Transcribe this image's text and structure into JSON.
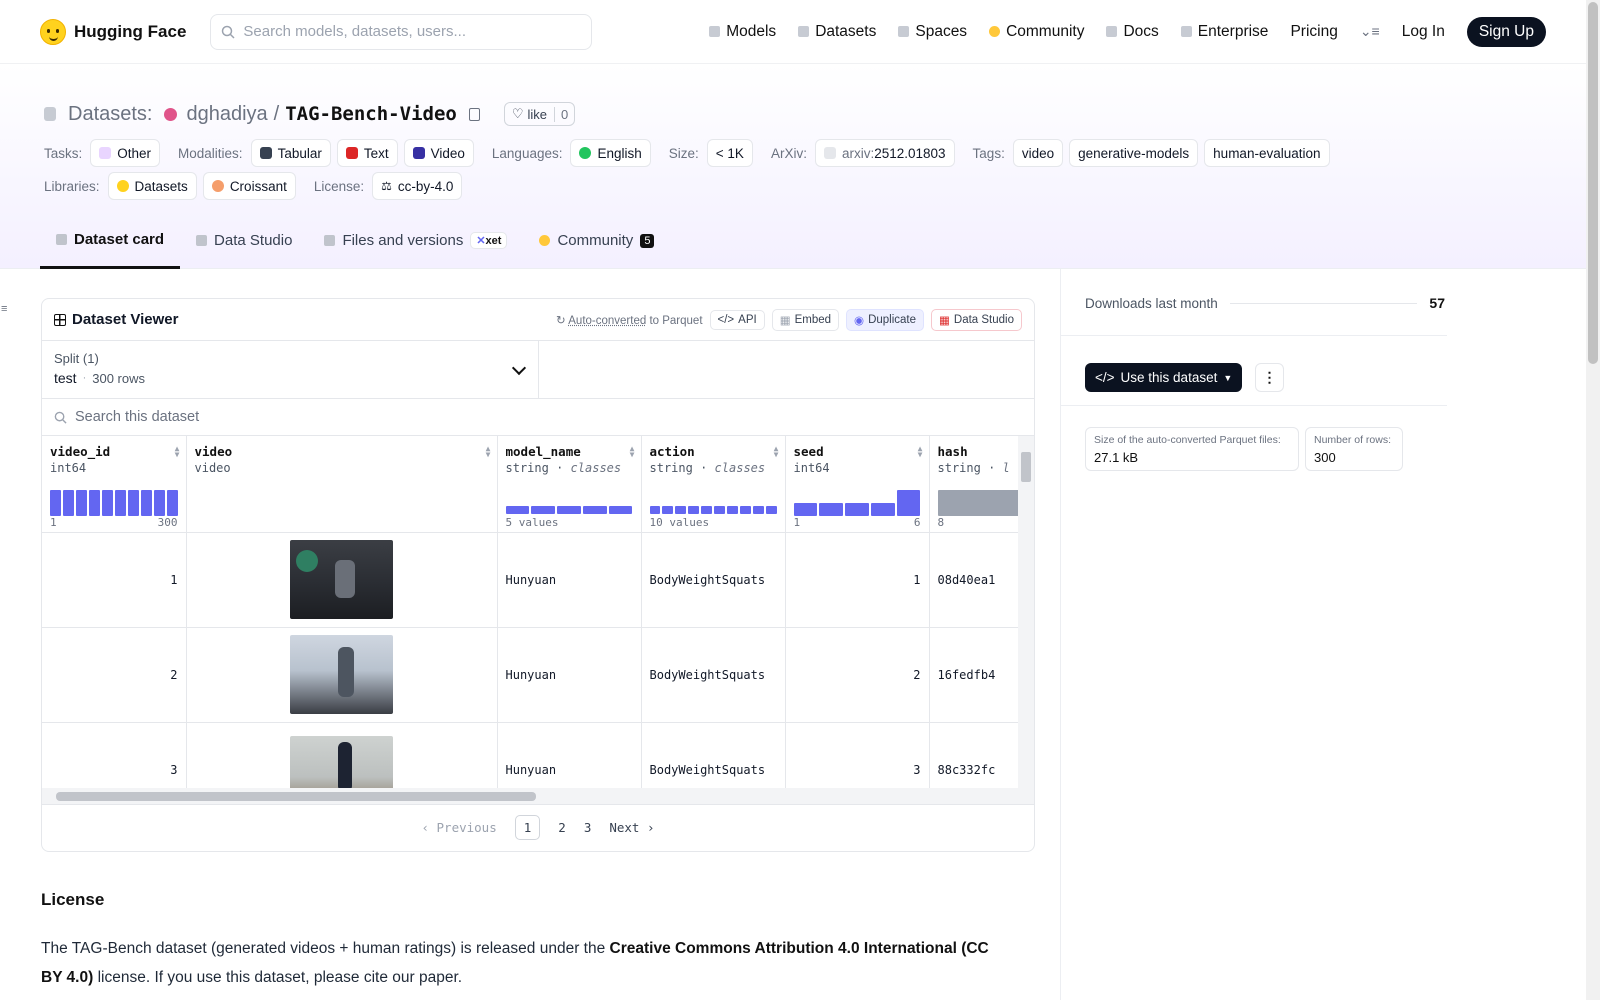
{
  "nav": {
    "brand": "Hugging Face",
    "search_placeholder": "Search models, datasets, users...",
    "links": [
      "Models",
      "Datasets",
      "Spaces",
      "Community",
      "Docs",
      "Enterprise",
      "Pricing"
    ],
    "login": "Log In",
    "signup": "Sign Up"
  },
  "repo": {
    "section": "Datasets:",
    "owner": "dghadiya",
    "separator": "/",
    "name": "TAG-Bench-Video",
    "like_label": "like",
    "like_count": "0"
  },
  "tags": {
    "tasks_label": "Tasks:",
    "tasks": [
      "Other"
    ],
    "modalities_label": "Modalities:",
    "modalities": [
      "Tabular",
      "Text",
      "Video"
    ],
    "languages_label": "Languages:",
    "languages": [
      "English"
    ],
    "size_label": "Size:",
    "size": "< 1K",
    "arxiv_label": "ArXiv:",
    "arxiv_prefix": "arxiv:",
    "arxiv_id": "2512.01803",
    "tags_label": "Tags:",
    "tags": [
      "video",
      "generative-models",
      "human-evaluation"
    ],
    "libraries_label": "Libraries:",
    "libraries": [
      "Datasets",
      "Croissant"
    ],
    "license_label": "License:",
    "license": "cc-by-4.0"
  },
  "tabs": {
    "dataset_card": "Dataset card",
    "data_studio": "Data Studio",
    "files": "Files and versions",
    "xet": "xet",
    "community": "Community",
    "community_count": "5"
  },
  "viewer": {
    "title": "Dataset Viewer",
    "auto_converted_prefix": "Auto-converted",
    "auto_converted_suffix": " to Parquet",
    "api": "API",
    "embed": "Embed",
    "duplicate": "Duplicate",
    "data_studio": "Data Studio",
    "split_label": "Split (1)",
    "split_value": "test",
    "split_rows": "300 rows",
    "search_placeholder": "Search this dataset",
    "columns": [
      {
        "name": "video_id",
        "type": "int64",
        "range_min": "1",
        "range_max": "300"
      },
      {
        "name": "video",
        "type": "video"
      },
      {
        "name": "model_name",
        "type": "string",
        "type_extra": "classes",
        "values_note": "5 values"
      },
      {
        "name": "action",
        "type": "string",
        "type_extra": "classes",
        "values_note": "10 values"
      },
      {
        "name": "seed",
        "type": "int64",
        "range_min": "1",
        "range_max": "6"
      },
      {
        "name": "hash",
        "type": "string",
        "type_extra": "l",
        "range_min": "8"
      }
    ],
    "histograms": {
      "video_id": [
        1,
        1,
        1,
        1,
        1,
        1,
        1,
        1,
        1,
        1
      ],
      "model_name": [
        1,
        1,
        1,
        1,
        1
      ],
      "action": [
        1,
        1,
        1,
        1,
        1,
        1,
        1,
        1,
        1,
        1
      ],
      "seed": [
        0.5,
        0.5,
        0.5,
        0.5,
        1.0
      ],
      "hash": [
        1
      ]
    },
    "rows": [
      {
        "video_id": "1",
        "model_name": "Hunyuan",
        "action": "BodyWeightSquats",
        "seed": "1",
        "hash": "08d40ea1"
      },
      {
        "video_id": "2",
        "model_name": "Hunyuan",
        "action": "BodyWeightSquats",
        "seed": "2",
        "hash": "16fedfb4"
      },
      {
        "video_id": "3",
        "model_name": "Hunyuan",
        "action": "BodyWeightSquats",
        "seed": "3",
        "hash": "88c332fc"
      }
    ],
    "pager": {
      "previous": "Previous",
      "pages": [
        "1",
        "2",
        "3"
      ],
      "current": "1",
      "next": "Next"
    }
  },
  "sidebar": {
    "downloads_label": "Downloads last month",
    "downloads_value": "57",
    "use_button": "Use this dataset",
    "parquet_size_label": "Size of the auto-converted Parquet files:",
    "parquet_size_value": "27.1 kB",
    "rows_label": "Number of rows:",
    "rows_value": "300"
  },
  "license_section": {
    "heading": "License",
    "text_before": "The TAG-Bench dataset (generated videos + human ratings) is released under the ",
    "text_bold": "Creative Commons Attribution 4.0 International (CC BY 4.0)",
    "text_after": " license. If you use this dataset, please cite our paper."
  },
  "colors": {
    "accent_indigo": "#6366f1",
    "primary_dark": "#0b1220",
    "owner_avatar": "#e0548a"
  }
}
